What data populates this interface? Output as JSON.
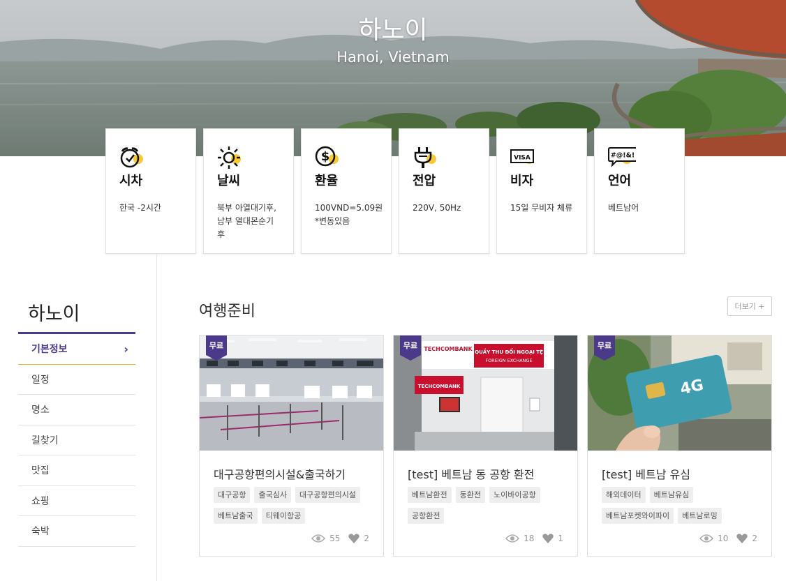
{
  "hero": {
    "title": "하노이",
    "subtitle": "Hanoi, Vietnam"
  },
  "info_cards": [
    {
      "id": "time",
      "icon": "alarm-clock-icon",
      "label": "시차",
      "desc": "한국 -2시간"
    },
    {
      "id": "weather",
      "icon": "sun-icon",
      "label": "날씨",
      "desc": "북부 아열대기후,\n남부 열대몬순기\n후"
    },
    {
      "id": "currency",
      "icon": "dollar-icon",
      "label": "환율",
      "desc": "100VND=5.09원\n*변동있음"
    },
    {
      "id": "voltage",
      "icon": "plug-icon",
      "label": "전압",
      "desc": "220V, 50Hz"
    },
    {
      "id": "visa",
      "icon": "visa-card-icon",
      "label": "비자",
      "desc": "15일 무비자 체류"
    },
    {
      "id": "language",
      "icon": "speech-bubble-icon",
      "label": "언어",
      "desc": "베트남어"
    }
  ],
  "visa_icon_text": "VISA",
  "language_icon_text": "#@!&!",
  "sidebar": {
    "title": "하노이",
    "items": [
      {
        "label": "기본정보",
        "active": true
      },
      {
        "label": "일정"
      },
      {
        "label": "명소"
      },
      {
        "label": "길찾기"
      },
      {
        "label": "맛집"
      },
      {
        "label": "쇼핑"
      },
      {
        "label": "숙박"
      }
    ]
  },
  "section": {
    "title": "여행준비",
    "more_label": "더보기 +",
    "cards": [
      {
        "badge": "무료",
        "title": "대구공항편의시설&출국하기",
        "tags": [
          "대구공항",
          "출국심사",
          "대구공항편의시설",
          "베트남출국",
          "티웨이항공"
        ],
        "views": "55",
        "likes": "2",
        "image_theme": "airport-counters"
      },
      {
        "badge": "무료",
        "title": "[test] 베트남 동 공항 환전",
        "tags": [
          "베트남환전",
          "동환전",
          "노이바이공항",
          "공항환전"
        ],
        "views": "18",
        "likes": "1",
        "image_theme": "techcombank-exchange",
        "sign_text_1": "TECHCOMBANK",
        "sign_text_2": "QUẦY THU ĐỔI NGOẠI TỆ",
        "sign_text_3": "FOREIGN EXCHANGE"
      },
      {
        "badge": "무료",
        "title": "[test] 베트남 유심",
        "tags": [
          "해외데이터",
          "베트남유심",
          "베트남포켓와이파이",
          "베트남로밍"
        ],
        "views": "10",
        "likes": "2",
        "image_theme": "sim-card-4g",
        "sim_text": "4G"
      }
    ]
  },
  "colors": {
    "accent_purple": "#4b3a8c",
    "accent_yellow": "#f7c934",
    "active_underline": "#f2b233"
  }
}
